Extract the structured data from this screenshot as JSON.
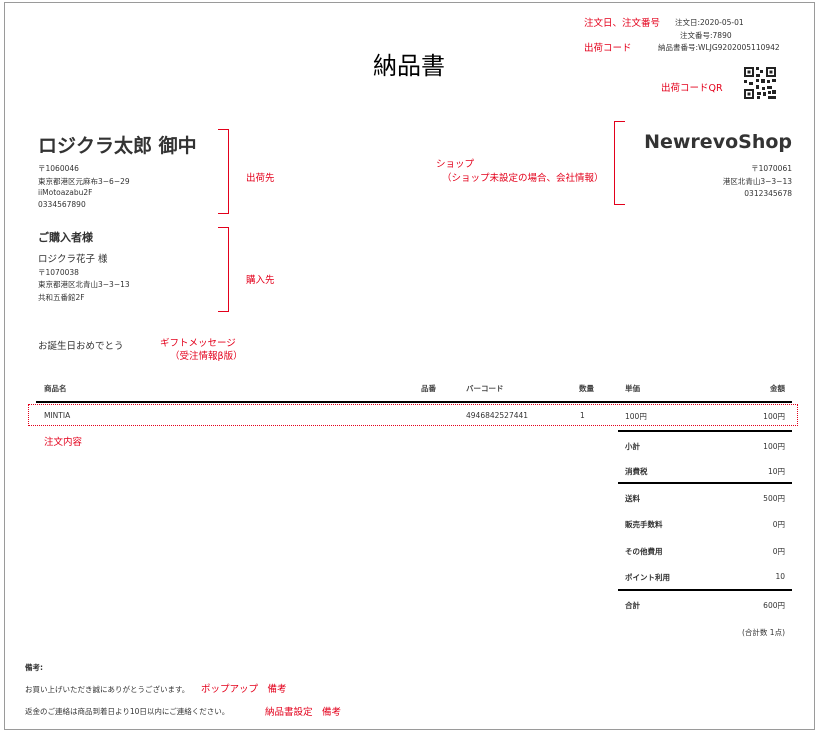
{
  "header": {
    "title": "納品書",
    "order_date": "注文日:2020-05-01",
    "order_number": "注文番号:7890",
    "slip_number": "納品書番号:WLJG9202005110942",
    "anno_order": "注文日、注文番号",
    "anno_shipping_code": "出荷コード",
    "anno_qr": "出荷コードQR"
  },
  "recipient": {
    "name": "ロジクラ太郎 御中",
    "postal": "〒1060046",
    "address1": "東京都港区元麻布3−6−29",
    "address2": "iiMotoazabu2F",
    "phone": "0334567890",
    "anno": "出荷先"
  },
  "buyer": {
    "heading": "ご購入者様",
    "name": "ロジクラ花子 様",
    "postal": "〒1070038",
    "address1": "東京都港区北青山3−3−13",
    "address2": "共和五番館2F",
    "anno": "購入先"
  },
  "shop": {
    "name": "NewrevoShop",
    "postal": "〒1070061",
    "address": "港区北青山3−3−13",
    "phone": "0312345678",
    "anno_line1": "ショップ",
    "anno_line2": "（ショップ未設定の場合、会社情報）"
  },
  "gift": {
    "message": "お誕生日おめでとう",
    "anno_line1": "ギフトメッセージ",
    "anno_line2": "（受注情報β版）"
  },
  "table": {
    "headers": {
      "product": "商品名",
      "sku": "品番",
      "barcode": "バーコード",
      "qty": "数量",
      "unit_price": "単価",
      "amount": "金額"
    },
    "rows": [
      {
        "product": "MINTIA",
        "sku": "",
        "barcode": "4946842527441",
        "qty": "1",
        "unit_price": "100円",
        "amount": "100円"
      }
    ],
    "anno": "注文内容"
  },
  "summary": {
    "subtotal_label": "小計",
    "subtotal": "100円",
    "tax_label": "消費税",
    "tax": "10円",
    "shipping_label": "送料",
    "shipping": "500円",
    "fee_label": "販売手数料",
    "fee": "0円",
    "other_label": "その他費用",
    "other": "0円",
    "points_label": "ポイント利用",
    "points": "10",
    "total_label": "合計",
    "total": "600円",
    "count": "(合計数 1点)"
  },
  "notes": {
    "label": "備考:",
    "line1": "お買い上げいただき誠にありがとうございます。",
    "line1_anno": "ポップアップ　備考",
    "line2": "返金のご連絡は商品到着日より10日以内にご連絡ください。",
    "line2_anno": "納品書設定　備考"
  },
  "colors": {
    "annotation": "#e3001b",
    "text": "#333333"
  }
}
